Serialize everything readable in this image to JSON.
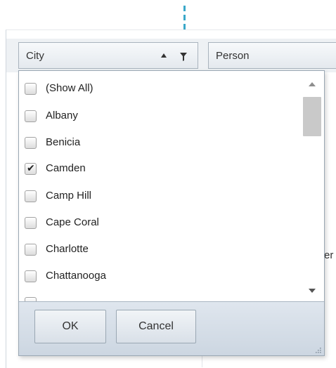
{
  "colors": {
    "callout": "#3aa8c9",
    "header_bg": "#e4e9ee",
    "footer_bg": "#d5dee8"
  },
  "columns": [
    {
      "label": "City",
      "sort": "ascending",
      "filter_active": true
    },
    {
      "label": "Person"
    }
  ],
  "filter_dropdown": {
    "items": [
      {
        "label": "(Show All)",
        "checked": false
      },
      {
        "label": "Albany",
        "checked": false
      },
      {
        "label": "Benicia",
        "checked": false
      },
      {
        "label": "Camden",
        "checked": true
      },
      {
        "label": "Camp Hill",
        "checked": false
      },
      {
        "label": "Cape Coral",
        "checked": false
      },
      {
        "label": "Charlotte",
        "checked": false
      },
      {
        "label": "Chattanooga",
        "checked": false
      }
    ],
    "ok_label": "OK",
    "cancel_label": "Cancel",
    "check_mark": "✔"
  },
  "background_fragment": "er"
}
